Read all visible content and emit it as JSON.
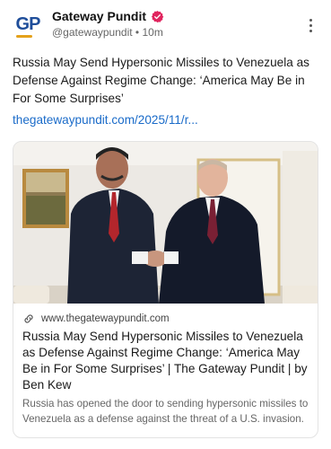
{
  "account": {
    "name": "Gateway Pundit",
    "handle": "@gatewaypundit",
    "separator": "•",
    "time": "10m",
    "avatar_text": "GP",
    "verified_color": "#e0245e"
  },
  "post": {
    "text": "Russia May Send Hypersonic Missiles to Venezuela as Defense Against Regime Change: ‘America May Be in For Some Surprises’",
    "link": "thegatewaypundit.com/2025/11/r..."
  },
  "card": {
    "domain": "www.thegatewaypundit.com",
    "title": "Russia May Send Hypersonic Missiles to Venezuela as Defense Against Regime Change: ‘America May Be in For Some Surprises’ | The Gateway Pundit | by Ben Kew",
    "description": "Russia has opened the door to sending hypersonic missiles to Venezuela as a defense against the threat of a U.S. invasion."
  },
  "icons": {
    "verified": "verified-badge-icon",
    "more": "more-vertical-icon",
    "link": "link-chain-icon"
  },
  "colors": {
    "link": "#1a6bc9",
    "brand_blue": "#1f4e9a",
    "brand_gold": "#e4a11b"
  }
}
